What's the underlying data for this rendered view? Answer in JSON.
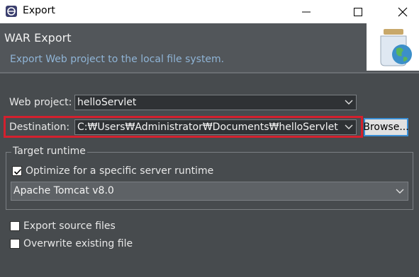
{
  "window": {
    "title": "Export"
  },
  "header": {
    "title": "WAR Export",
    "description": "Export Web project to the local file system."
  },
  "form": {
    "web_project_label": "Web project:",
    "web_project_value": "helloServlet",
    "destination_label": "Destination:",
    "destination_value": "C:₩Users₩Administrator₩Documents₩helloServlet.war",
    "browse_label": "Browse..."
  },
  "target_runtime": {
    "legend": "Target runtime",
    "optimize_label": "Optimize for a specific server runtime",
    "optimize_checked": true,
    "runtime_value": "Apache Tomcat v8.0"
  },
  "options": {
    "export_source_label": "Export source files",
    "export_source_checked": false,
    "overwrite_label": "Overwrite existing file",
    "overwrite_checked": false
  },
  "colors": {
    "highlight": "#d4202e",
    "header_desc": "#8fb4d6"
  }
}
